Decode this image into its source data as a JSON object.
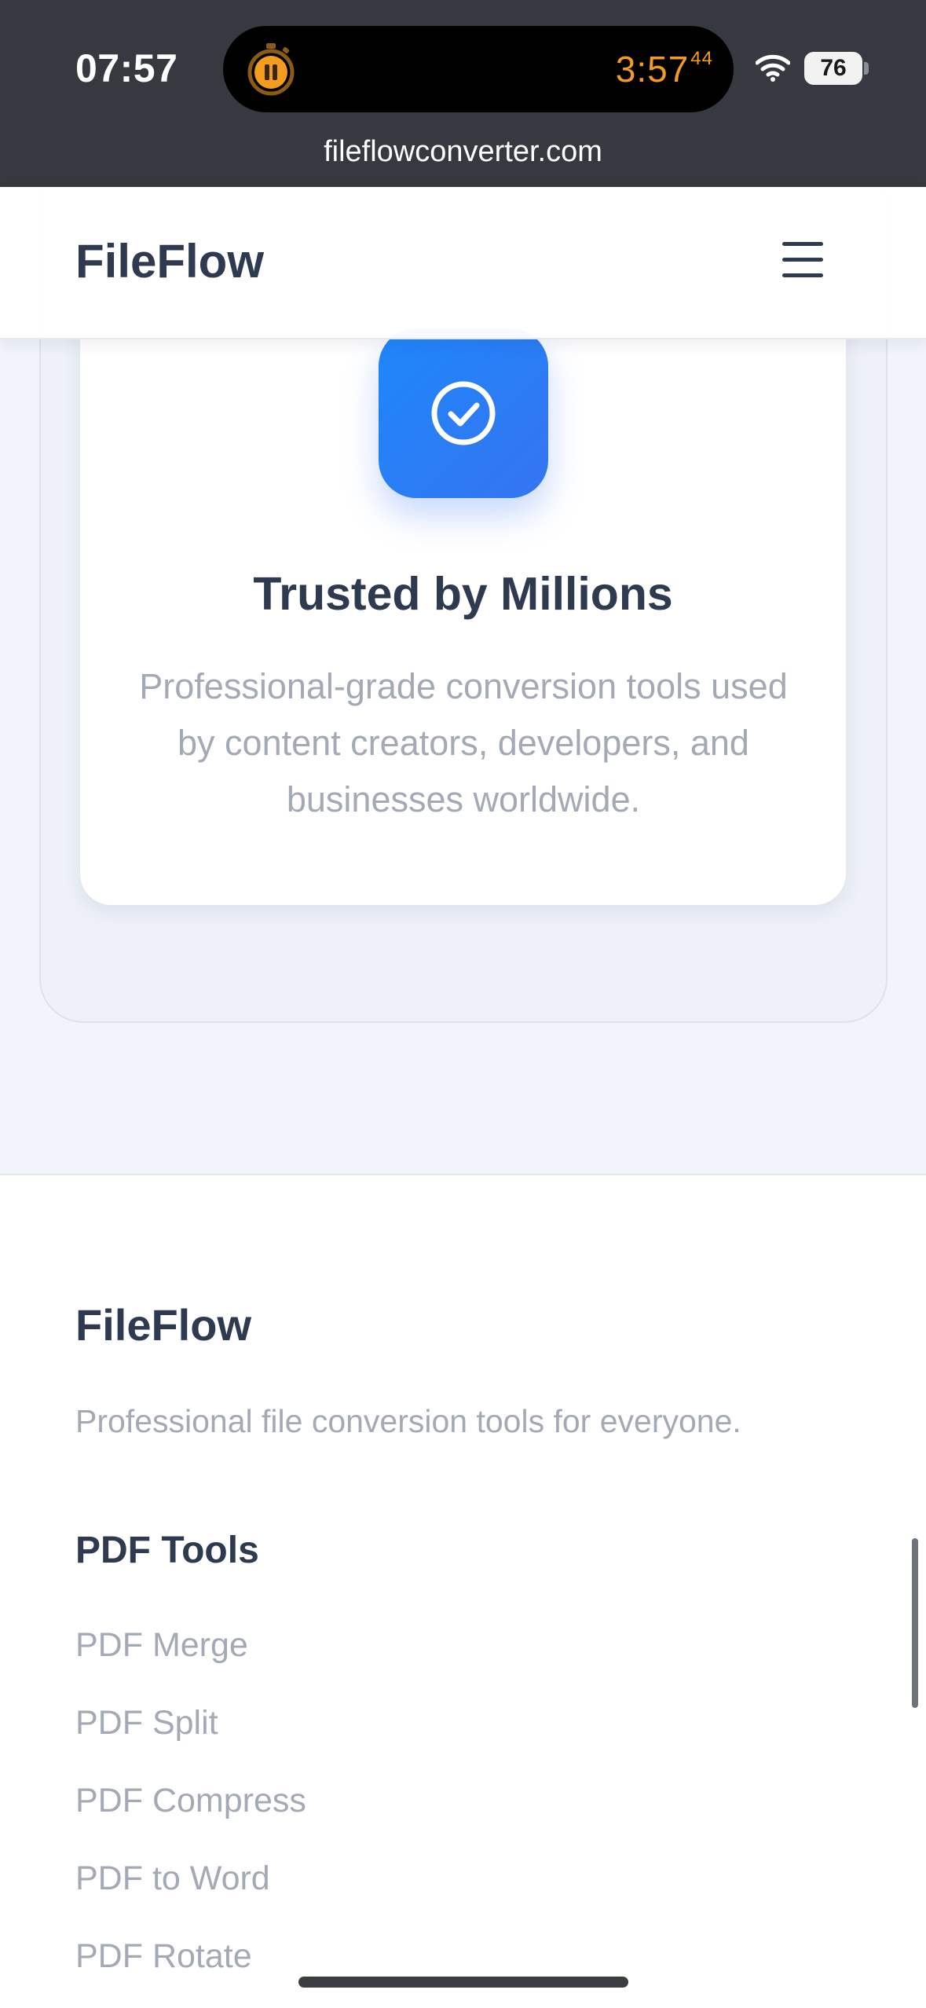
{
  "status_bar": {
    "time": "07:57",
    "timer_main": "3:57",
    "timer_fraction": "44",
    "battery_level": "76",
    "url": "fileflowconverter.com"
  },
  "header": {
    "logo": "FileFlow",
    "menu_icon": "hamburger-menu-icon"
  },
  "feature": {
    "icon": "check-circle-icon",
    "title": "Trusted by Millions",
    "description": "Professional-grade conversion tools used by content creators, developers, and businesses worldwide."
  },
  "footer": {
    "brand": "FileFlow",
    "tagline": "Professional file conversion tools for everyone.",
    "pdf_tools": {
      "heading": "PDF Tools",
      "links": [
        "PDF Merge",
        "PDF Split",
        "PDF Compress",
        "PDF to Word",
        "PDF Rotate"
      ]
    }
  },
  "colors": {
    "accent_blue": "#2f7df6",
    "heading": "#2e3a4f",
    "muted_text": "#a3a9b5",
    "timer_orange": "#f39c1f",
    "status_bar_bg": "#363a40"
  }
}
